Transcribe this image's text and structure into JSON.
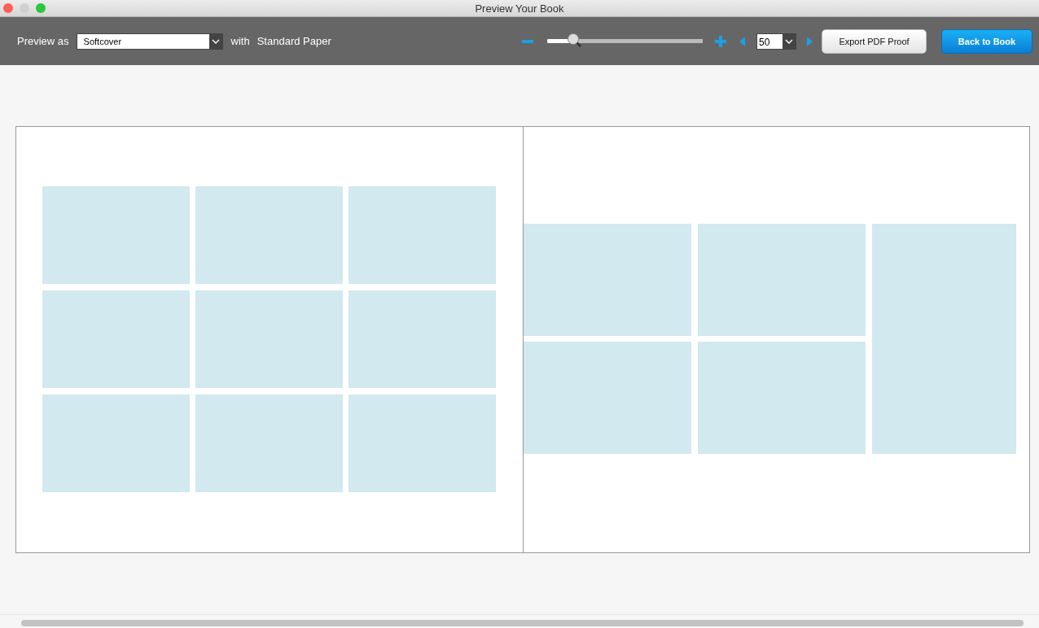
{
  "window": {
    "title": "Preview Your Book"
  },
  "toolbar": {
    "preview_label": "Preview as",
    "format": "Softcover",
    "with_label": "with",
    "paper": "Standard Paper",
    "zoom": {
      "level": 0.17
    },
    "page": "50",
    "export_button": "Export PDF Proof",
    "back_button": "Back to Book"
  },
  "spread": {
    "pages": [
      {
        "kind": "grid3x3",
        "slots": [
          {
            "kind": "normal"
          },
          {
            "kind": "normal"
          },
          {
            "kind": "normal"
          },
          {
            "kind": "normal"
          },
          {
            "kind": "normal"
          },
          {
            "kind": "normal"
          },
          {
            "kind": "normal"
          },
          {
            "kind": "normal"
          },
          {
            "kind": "normal"
          }
        ]
      },
      {
        "kind": "grid2x3",
        "slots": [
          {
            "kind": "normal"
          },
          {
            "kind": "normal"
          },
          {
            "kind": "tall"
          },
          {
            "kind": "normal"
          },
          {
            "kind": "normal"
          }
        ]
      }
    ]
  }
}
